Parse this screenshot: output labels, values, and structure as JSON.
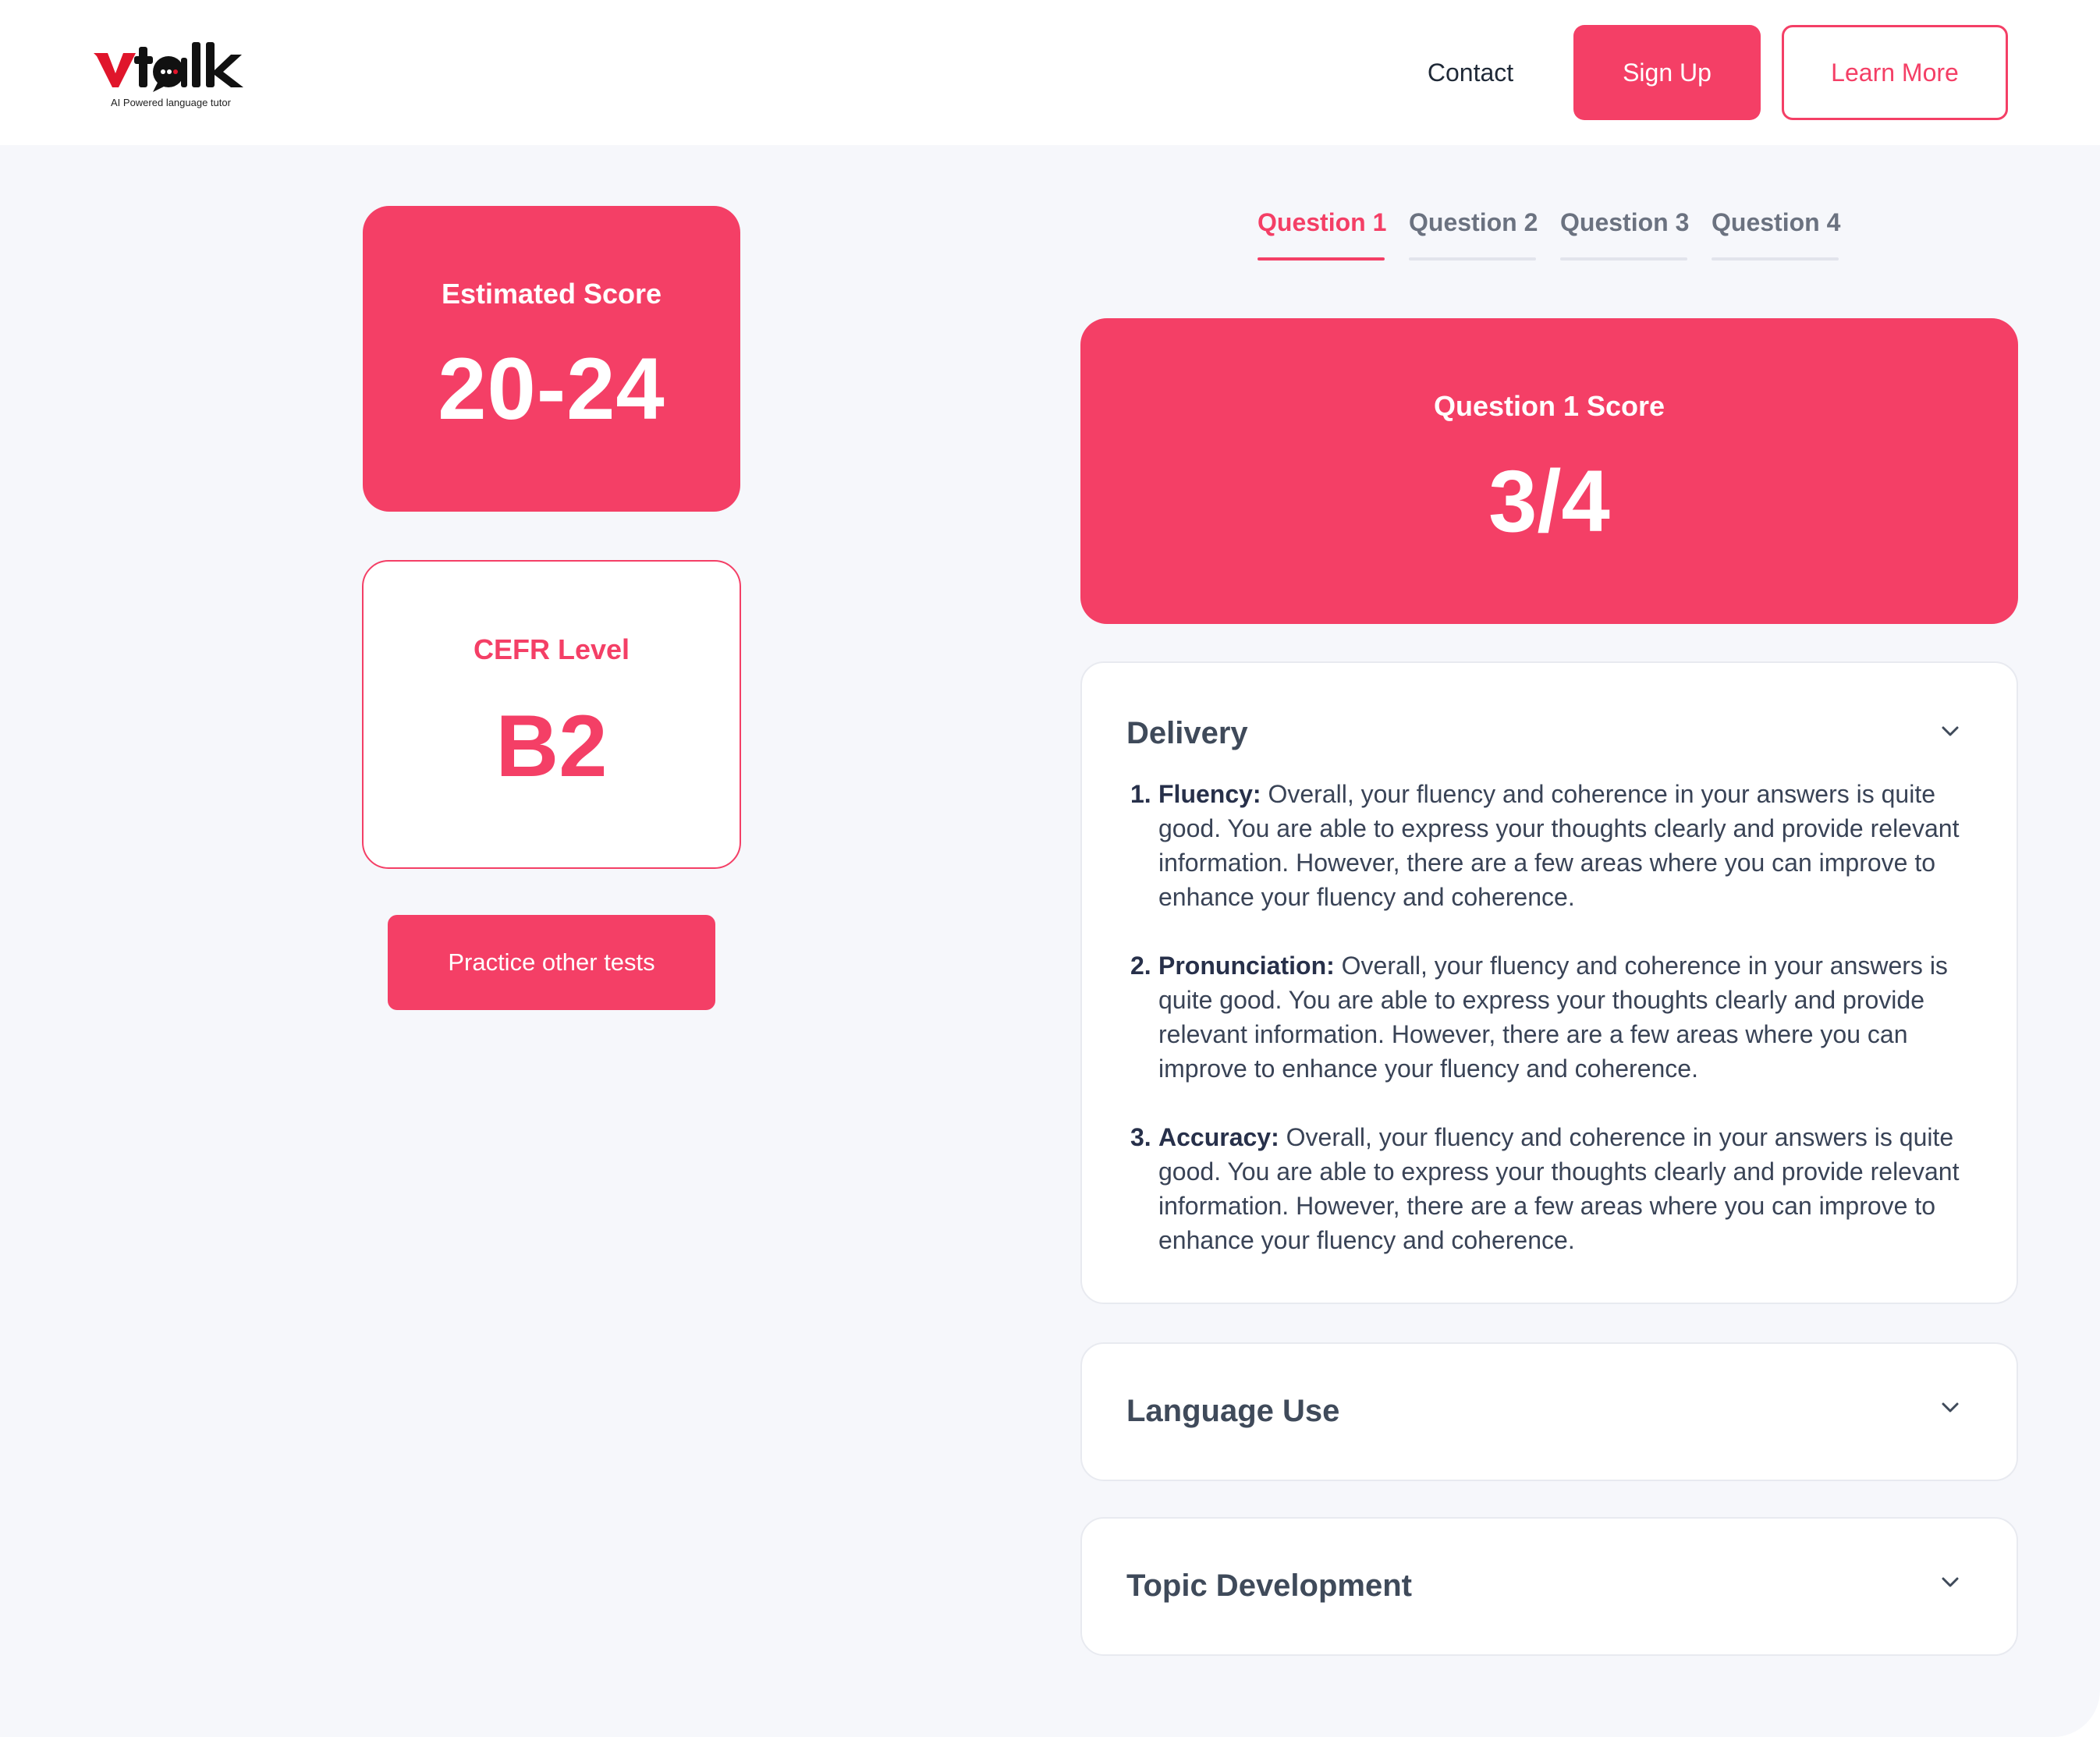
{
  "brand": {
    "tagline": "AI Powered language tutor",
    "accent_color": "#f43f66",
    "logo_colors": [
      "#e0152b",
      "#111111"
    ]
  },
  "header": {
    "contact_label": "Contact",
    "signup_label": "Sign Up",
    "learn_more_label": "Learn More"
  },
  "summary": {
    "estimated_label": "Estimated Score",
    "estimated_value": "20-24",
    "cefr_label": "CEFR Level",
    "cefr_value": "B2",
    "practice_label": "Practice other tests"
  },
  "tabs": [
    {
      "label": "Question 1",
      "active": true
    },
    {
      "label": "Question 2",
      "active": false
    },
    {
      "label": "Question 3",
      "active": false
    },
    {
      "label": "Question 4",
      "active": false
    }
  ],
  "question_score": {
    "label": "Question 1 Score",
    "value": "3/4"
  },
  "sections": {
    "delivery": {
      "title": "Delivery",
      "icon": "chevron-down-icon",
      "items": [
        {
          "num": "1.",
          "term": "Fluency:",
          "text": " Overall, your fluency and coherence in your answers is quite good. You are able to express your thoughts clearly and provide relevant information. However, there are a few areas where you can improve to enhance your fluency and coherence."
        },
        {
          "num": "2.",
          "term": "Pronunciation:",
          "text": " Overall, your fluency and coherence in your answers is quite good. You are able to express your thoughts clearly and provide relevant information. However, there are a few areas where you can improve to enhance your fluency and coherence."
        },
        {
          "num": "3.",
          "term": "Accuracy:",
          "text": " Overall, your fluency and coherence in your answers is quite good. You are able to express your thoughts clearly and provide relevant information. However, there are a few areas where you can improve to enhance your fluency and coherence."
        }
      ]
    },
    "language_use": {
      "title": "Language Use",
      "icon": "chevron-down-icon"
    },
    "topic_development": {
      "title": "Topic Development",
      "icon": "chevron-down-icon"
    }
  }
}
